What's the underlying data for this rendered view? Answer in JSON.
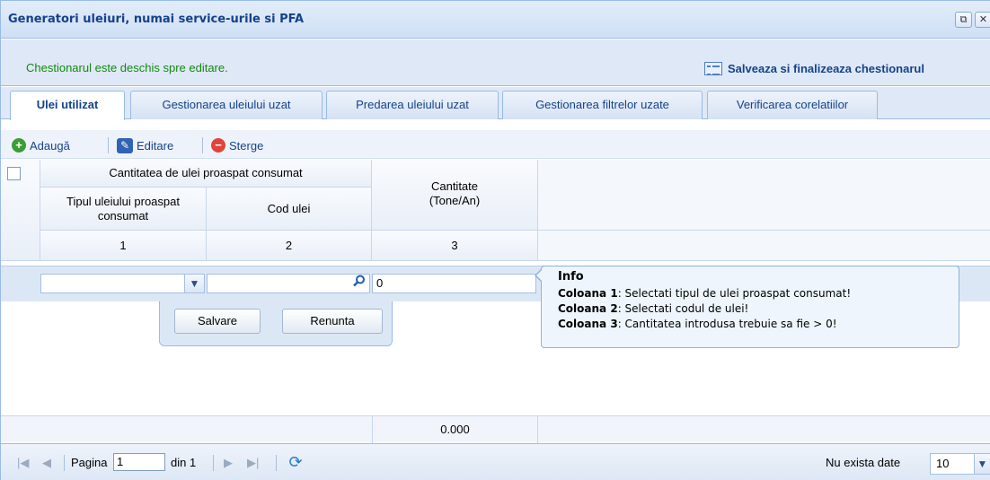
{
  "window": {
    "title": "Generatori uleiuri, numai service-urile si PFA",
    "restore_icon": "restore-icon",
    "close_icon": "close-icon"
  },
  "status": {
    "text": "Chestionarul este deschis spre editare.",
    "finalize_label": "Salveaza si finalizeaza chestionarul",
    "color": "#118a11"
  },
  "tabs": [
    {
      "label": "Ulei utilizat",
      "active": true
    },
    {
      "label": "Gestionarea uleiului uzat",
      "active": false
    },
    {
      "label": "Predarea uleiului uzat",
      "active": false
    },
    {
      "label": "Gestionarea filtrelor uzate",
      "active": false
    },
    {
      "label": "Verificarea corelatiilor",
      "active": false
    }
  ],
  "toolbar": {
    "add_label": "Adaugă",
    "edit_label": "Editare",
    "delete_label": "Sterge"
  },
  "grid": {
    "group_header": "Cantitatea de ulei proaspat consumat",
    "col1_header": "Tipul uleiului proaspat consumat",
    "col2_header": "Cod ulei",
    "col3_header": "Cantitate (Tone/An)",
    "col_numbers": [
      "1",
      "2",
      "3"
    ],
    "edit_row": {
      "col1_value": "",
      "col2_value": "",
      "col3_value": "0"
    },
    "save_button": "Salvare",
    "cancel_button": "Renunta",
    "total": "0.000"
  },
  "tooltip": {
    "title": "Info",
    "lines": [
      {
        "label": "Coloana 1",
        "text": ": Selectati tipul de ulei proaspat consumat!"
      },
      {
        "label": "Coloana 2",
        "text": ": Selectati codul de ulei!"
      },
      {
        "label": "Coloana 3",
        "text": ": Cantitatea introdusa trebuie sa fie > 0!"
      }
    ]
  },
  "pager": {
    "page_label": "Pagina",
    "page_value": "1",
    "of_label": "din 1",
    "no_data": "Nu exista date",
    "page_size": "10"
  }
}
